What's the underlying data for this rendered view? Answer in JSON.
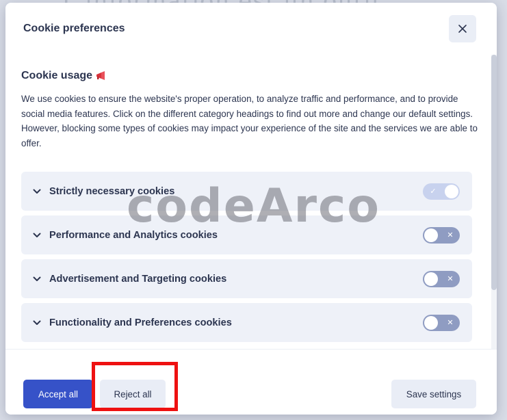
{
  "background": {
    "text": "L'information est un outil ..."
  },
  "modal": {
    "title": "Cookie preferences",
    "close_icon": "close-icon",
    "section_title": "Cookie usage",
    "section_icon": "megaphone-icon",
    "description": "We use cookies to ensure the website's proper operation, to analyze traffic and performance, and to provide social media features. Click on the different category headings to find out more and change our default settings. However, blocking some types of cookies may impact your experience of the site and the services we are able to offer.",
    "categories": [
      {
        "label": "Strictly necessary cookies",
        "enabled": true,
        "locked": true
      },
      {
        "label": "Performance and Analytics cookies",
        "enabled": false
      },
      {
        "label": "Advertisement and Targeting cookies",
        "enabled": false
      },
      {
        "label": "Functionality and Preferences cookies",
        "enabled": false
      }
    ]
  },
  "footer": {
    "accept_label": "Accept all",
    "reject_label": "Reject all",
    "save_label": "Save settings"
  },
  "watermark": "codeArco",
  "colors": {
    "primary": "#3652c8",
    "toggle_off": "#8f9cc2",
    "toggle_on_disabled": "#c8d2ee",
    "category_bg": "#eef1f8",
    "highlight": "#ee1111"
  }
}
